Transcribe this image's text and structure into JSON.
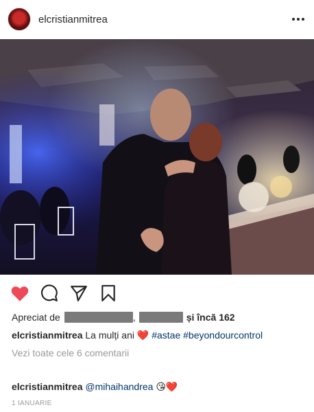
{
  "post": {
    "username": "elcristianmitrea",
    "likes": {
      "prefix": "Apreciat de",
      "separator": ",",
      "suffix": "și încă 162"
    },
    "caption": {
      "username": "elcristianmitrea",
      "text": "La mulți ani",
      "emoji": "❤️",
      "hashtags": [
        "#astae",
        "#beyondourcontrol"
      ]
    },
    "view_comments": "Vezi toate cele 6 comentarii",
    "comment": {
      "username": "elcristianmitrea",
      "mention": "@mihaihandrea",
      "emoji": "😘❤️"
    },
    "timestamp": "1 IANUARIE"
  },
  "colors": {
    "like_red": "#ed4956",
    "link_blue": "#003569",
    "muted_gray": "#999999"
  },
  "icons": {
    "like": "heart-icon",
    "comment": "comment-icon",
    "share": "paper-plane-icon",
    "save": "bookmark-icon",
    "more": "more-dots-icon"
  }
}
